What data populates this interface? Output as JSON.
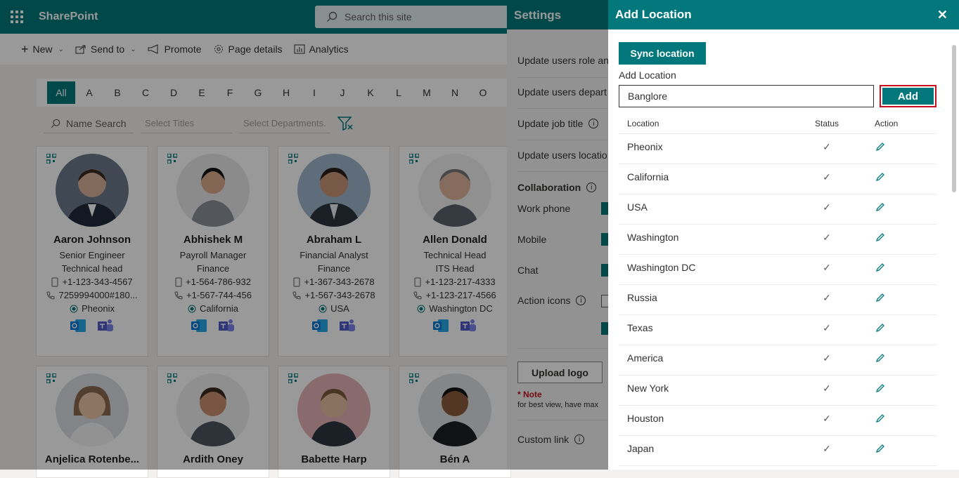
{
  "app": {
    "title": "SharePoint",
    "search_placeholder": "Search this site"
  },
  "commands": [
    {
      "label": "New",
      "icon": "plus-icon",
      "has_menu": true
    },
    {
      "label": "Send to",
      "icon": "share-icon",
      "has_menu": true
    },
    {
      "label": "Promote",
      "icon": "megaphone-icon",
      "has_menu": false
    },
    {
      "label": "Page details",
      "icon": "gear-icon",
      "has_menu": false
    },
    {
      "label": "Analytics",
      "icon": "chart-icon",
      "has_menu": false
    }
  ],
  "alphabet": [
    "All",
    "A",
    "B",
    "C",
    "D",
    "E",
    "F",
    "G",
    "H",
    "I",
    "J",
    "K",
    "L",
    "M",
    "N",
    "O"
  ],
  "filters": {
    "name_search": "Name Search",
    "titles": "Select Titles",
    "departments": "Select Departments."
  },
  "people": [
    {
      "name": "Aaron Johnson",
      "title": "Senior Engineer",
      "dept": "Technical head",
      "phone": "+1-123-343-4567",
      "landline": "7259994000#180...",
      "location": "Pheonix"
    },
    {
      "name": "Abhishek M",
      "title": "Payroll Manager",
      "dept": "Finance",
      "phone": "+1-564-786-932",
      "landline": "+1-567-744-456",
      "location": "California"
    },
    {
      "name": "Abraham L",
      "title": "Financial Analyst",
      "dept": "Finance",
      "phone": "+1-367-343-2678",
      "landline": "+1-567-343-2678",
      "location": "USA"
    },
    {
      "name": "Allen Donald",
      "title": "Technical Head",
      "dept": "ITS Head",
      "phone": "+1-123-217-4333",
      "landline": "+1-123-217-4566",
      "location": "Washington DC"
    },
    {
      "name": "Anjelica Rotenbe..."
    },
    {
      "name": "Ardith Oney"
    },
    {
      "name": "Babette Harp"
    },
    {
      "name": "Bén A"
    }
  ],
  "settings": {
    "title": "Settings",
    "rows": {
      "role": "Update users role an",
      "dept": "Update users depart",
      "job": "Update job title",
      "location": "Update users locatio",
      "collaboration": "Collaboration",
      "work_phone": "Work phone",
      "mobile": "Mobile",
      "chat": "Chat",
      "action_icons": "Action icons",
      "upload_logo": "Upload logo",
      "note_title": "* Note",
      "note_text": "for best view, have max",
      "custom_link": "Custom link"
    }
  },
  "panel": {
    "title": "Add Location",
    "sync_label": "Sync location",
    "add_label": "Add Location",
    "input_value": "Banglore",
    "add_button": "Add",
    "columns": {
      "location": "Location",
      "status": "Status",
      "action": "Action"
    },
    "rows": [
      {
        "location": "Pheonix",
        "status": "✓"
      },
      {
        "location": "California",
        "status": "✓"
      },
      {
        "location": "USA",
        "status": "✓"
      },
      {
        "location": "Washington",
        "status": "✓"
      },
      {
        "location": "Washington DC",
        "status": "✓"
      },
      {
        "location": "Russia",
        "status": "✓"
      },
      {
        "location": "Texas",
        "status": "✓"
      },
      {
        "location": "America",
        "status": "✓"
      },
      {
        "location": "New York",
        "status": "✓"
      },
      {
        "location": "Houston",
        "status": "✓"
      },
      {
        "location": "Japan",
        "status": "✓"
      }
    ]
  },
  "colors": {
    "brand": "#03787c",
    "highlight": "#c50f1f"
  }
}
